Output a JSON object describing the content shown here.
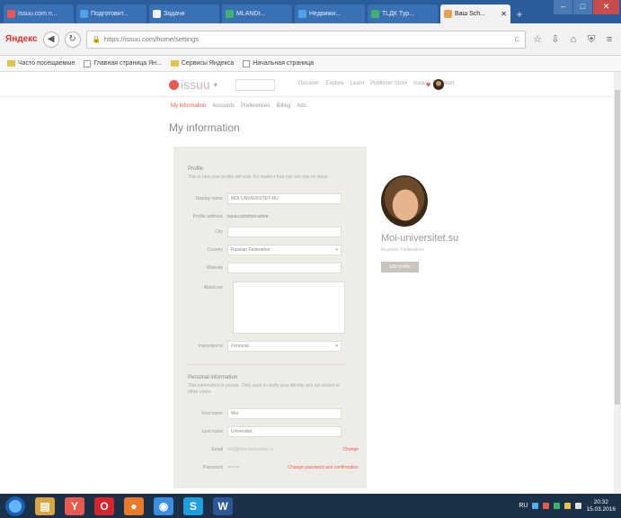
{
  "browser": {
    "tabs": [
      {
        "label": "Issuu.com n...",
        "color": "#e85a4f"
      },
      {
        "label": "Подготовит...",
        "color": "#4fa3e8"
      },
      {
        "label": "Задачи",
        "color": "#f2f2f2"
      },
      {
        "label": "MLANDr...",
        "color": "#3fb36a"
      },
      {
        "label": "Недвижи...",
        "color": "#4fa3e8"
      },
      {
        "label": "TLДК Тур...",
        "color": "#3fb36a"
      },
      {
        "label": "Ваш Sch...",
        "color": "#e8a04f",
        "active": true
      }
    ],
    "new_tab": "+",
    "brand": "Яндекс",
    "url": "https://issuu.com/home/settings",
    "url_host": "issuu.com",
    "url_tail": "C",
    "bookmarks": [
      "Часто посещаемые",
      "Главная страница Ян...",
      "Сервисы Яндекса",
      "Начальная страница"
    ]
  },
  "issuu": {
    "logo": "issuu",
    "nav": [
      "Discover",
      "Explore",
      "Learn",
      "Publisher Store",
      "Issuu",
      "Premium"
    ],
    "subtabs": [
      "My information",
      "Accounts",
      "Preferences",
      "Billing",
      "Ads"
    ],
    "page_title": "My information",
    "profile_section": {
      "title": "Profile",
      "desc": "This is how your profile will look. It's readers that can see you on issuu",
      "display_name_label": "Display name",
      "display_name_value": "MOI-UNIVERSITET-RU",
      "profile_url_label": "Profile address",
      "profile_url_value": "issuu.com/moi-unive",
      "city_label": "City",
      "city_value": "",
      "country_label": "Country",
      "country_value": "Russian Federation",
      "website_label": "Website",
      "website_value": "",
      "about_label": "About me",
      "interests_label": "Interested in",
      "interests_value": "Personal"
    },
    "personal_section": {
      "title": "Personal information",
      "desc": "This information is private. Only used to verify your identity and not shown to other users.",
      "first_name_label": "First name",
      "first_name_value": "Moi",
      "last_name_label": "Last name",
      "last_name_value": "Universitet",
      "email_label": "Email",
      "email_value": "moi@moi-universitet.ru",
      "email_link": "Change",
      "password_label": "Password",
      "password_value": "••••••••",
      "password_link": "Change password and confirmation"
    },
    "profile_card": {
      "name": "Moi-universitet.su",
      "subtitle": "Russian Federation",
      "button": "Edit profile"
    }
  },
  "taskbar": {
    "apps": [
      {
        "name": "explorer",
        "color": "#d9a441",
        "glyph": "▤"
      },
      {
        "name": "yandex-browser",
        "color": "#e85a4f",
        "glyph": "Y"
      },
      {
        "name": "opera",
        "color": "#d8232a",
        "glyph": "O"
      },
      {
        "name": "firefox",
        "color": "#e87a2a",
        "glyph": "●"
      },
      {
        "name": "chrome",
        "color": "#3a8ee0",
        "glyph": "◉"
      },
      {
        "name": "skype",
        "color": "#1ea0e0",
        "glyph": "S"
      },
      {
        "name": "word",
        "color": "#2b5797",
        "glyph": "W"
      }
    ],
    "lang": "RU",
    "time": "20:32",
    "date": "15.03.2016"
  }
}
